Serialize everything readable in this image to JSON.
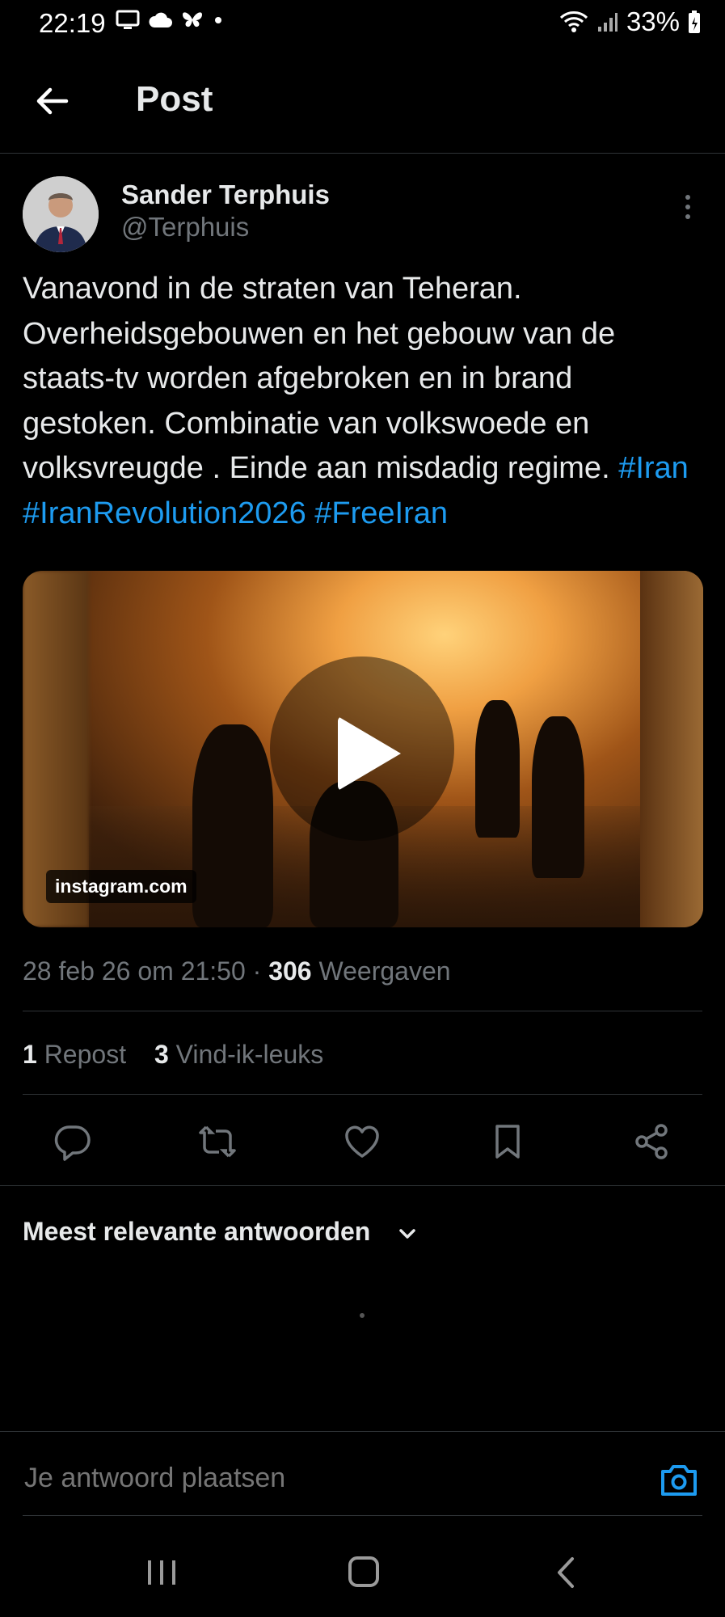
{
  "status_bar": {
    "time": "22:19",
    "battery": "33%"
  },
  "header": {
    "title": "Post"
  },
  "author": {
    "name": "Sander Terphuis",
    "handle": "@Terphuis"
  },
  "tweet": {
    "text": "Vanavond in de straten van Teheran. Overheidsgebouwen en het gebouw van de staats-tv worden afgebroken en in brand gestoken. Combinatie van volkswoede en volksvreugde . Einde aan misdadig regime.",
    "hashtags": [
      "#Iran",
      "#IranRevolution2026",
      "#FreeIran"
    ]
  },
  "media": {
    "source": "instagram.com"
  },
  "meta": {
    "timestamp": "28 feb 26 om 21:50",
    "separator": "·",
    "views_count": "306",
    "views_label": "Weergaven"
  },
  "engagement": {
    "reposts_count": "1",
    "reposts_label": "Repost",
    "likes_count": "3",
    "likes_label": "Vind-ik-leuks"
  },
  "replies": {
    "sort_label": "Meest relevante antwoorden"
  },
  "composer": {
    "placeholder": "Je antwoord plaatsen"
  },
  "colors": {
    "accent": "#1d9bf0",
    "background": "#000000",
    "text_primary": "#e7e9ea",
    "text_secondary": "#71767b",
    "divider": "#2f3336"
  },
  "icons": {
    "back": "arrow-left-icon",
    "more": "more-vertical-icon",
    "reply": "reply-icon",
    "repost": "repost-icon",
    "like": "heart-icon",
    "bookmark": "bookmark-icon",
    "share": "share-icon",
    "camera": "camera-icon"
  }
}
